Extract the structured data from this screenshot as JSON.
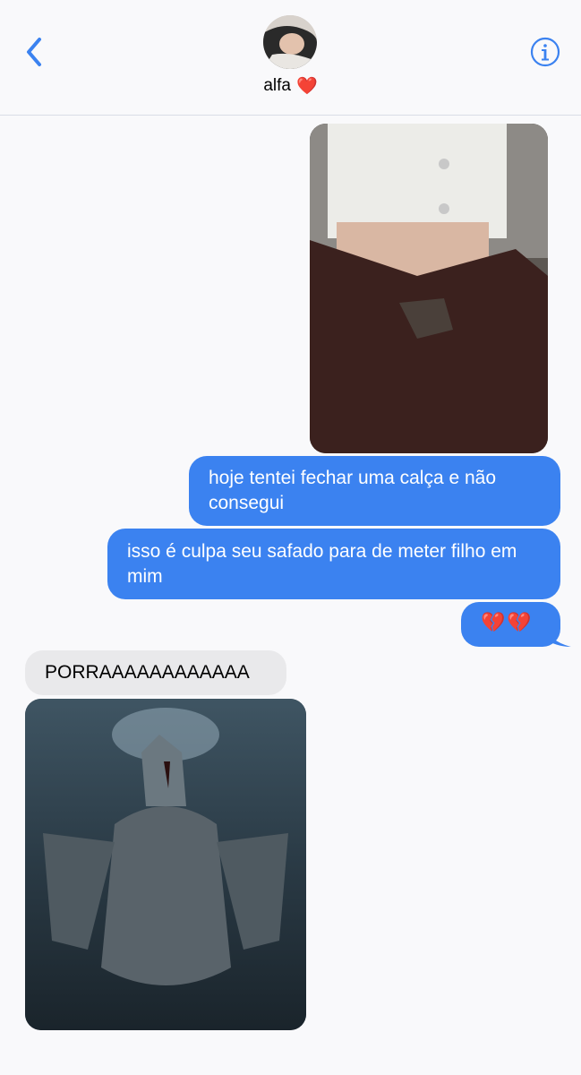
{
  "header": {
    "back_icon": "chevron-left-icon",
    "contact_name": "alfa",
    "contact_emoji": "❤️",
    "info_icon": "info-circle-icon",
    "accent_color": "#3b82f0"
  },
  "messages": [
    {
      "direction": "outgoing",
      "type": "image",
      "description_icon": "photo"
    },
    {
      "direction": "outgoing",
      "type": "text",
      "text": "hoje tentei fechar uma calça e não consegui"
    },
    {
      "direction": "outgoing",
      "type": "text",
      "text": "isso é culpa seu safado para de meter filho em mim"
    },
    {
      "direction": "outgoing",
      "type": "text",
      "text": "💔💔"
    },
    {
      "direction": "incoming",
      "type": "text",
      "text": "PORRAAAAAAAAAAAA"
    },
    {
      "direction": "incoming",
      "type": "image",
      "description_icon": "photo"
    }
  ],
  "colors": {
    "outgoing_bubble": "#3b82f0",
    "incoming_bubble": "#e9e9eb",
    "background": "#f9f9fb"
  }
}
